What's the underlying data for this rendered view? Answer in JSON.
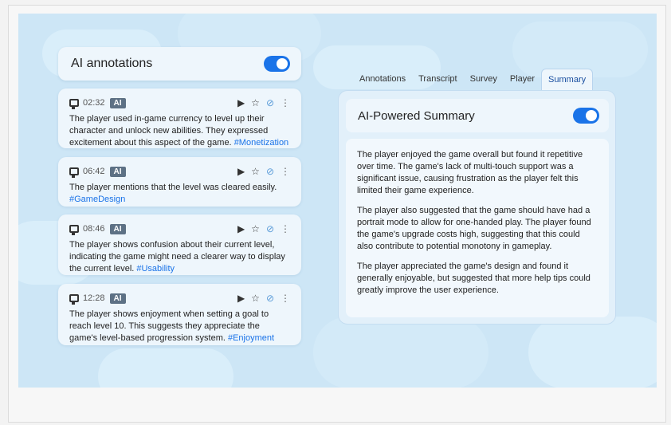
{
  "annotations_panel": {
    "title": "AI annotations",
    "toggle_on": true
  },
  "annotation_cards": [
    {
      "time": "02:32",
      "badge": "AI",
      "text": "The player used in-game currency to level up their character and unlock new abilities. They expressed excitement about this aspect of the game. ",
      "tag": "#Monetization"
    },
    {
      "time": "06:42",
      "badge": "AI",
      "text": "The player mentions that the level was cleared easily. ",
      "tag": "#GameDesign"
    },
    {
      "time": "08:46",
      "badge": "AI",
      "text": "The player shows confusion about their current level, indicating the game might need a clearer way to display the current level. ",
      "tag": "#Usability"
    },
    {
      "time": "12:28",
      "badge": "AI",
      "text": "The player shows enjoyment when setting a goal to reach level 10. This suggests they appreciate the game's level-based progression system. ",
      "tag": "#Enjoyment"
    }
  ],
  "card_actions": {
    "play": "▶",
    "star": "☆",
    "link": "🔗",
    "more": "⋮"
  },
  "tabs": [
    {
      "label": "Annotations",
      "active": false
    },
    {
      "label": "Transcript",
      "active": false
    },
    {
      "label": "Survey",
      "active": false
    },
    {
      "label": "Player",
      "active": false
    },
    {
      "label": "Summary",
      "active": true
    }
  ],
  "summary": {
    "title": "AI-Powered Summary",
    "toggle_on": true,
    "paragraphs": [
      "The player enjoyed the game overall but found it repetitive over time. The game's lack of multi-touch support was a significant issue, causing frustration as the player felt this limited their game experience.",
      "The player also suggested that the game should have had a portrait mode to allow for one-handed play. The player found the game's upgrade costs high, suggesting that this could also contribute to potential monotony in gameplay.",
      "The player appreciated the game's design and found it generally enjoyable, but suggested that more help tips could greatly improve the user experience."
    ]
  },
  "colors": {
    "accent": "#1a73e8",
    "background_sky": "#cde6f6",
    "card": "#eef6fc",
    "badge": "#5d7185"
  }
}
